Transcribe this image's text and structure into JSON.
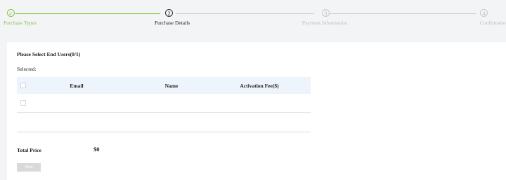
{
  "stepper": {
    "steps": [
      {
        "label": "Purchase Types",
        "marker": "✓",
        "state": "completed"
      },
      {
        "label": "Purchase Details",
        "marker": "2",
        "state": "active"
      },
      {
        "label": "Payment Information",
        "marker": "3",
        "state": "pending"
      },
      {
        "label": "Confirmation",
        "marker": "4",
        "state": "pending"
      }
    ],
    "colors": {
      "completed": "#8bc34a",
      "active": "#222222",
      "pending": "#bdbdbd"
    }
  },
  "section": {
    "title": "Please Select End Users(0/1)",
    "selected_label": "Selected:"
  },
  "table": {
    "columns": [
      "Email",
      "Name",
      "Activation Fee($)"
    ],
    "rows": []
  },
  "total": {
    "label": "Total Price",
    "value": "$0"
  },
  "actions": {
    "next_label": "Next"
  }
}
